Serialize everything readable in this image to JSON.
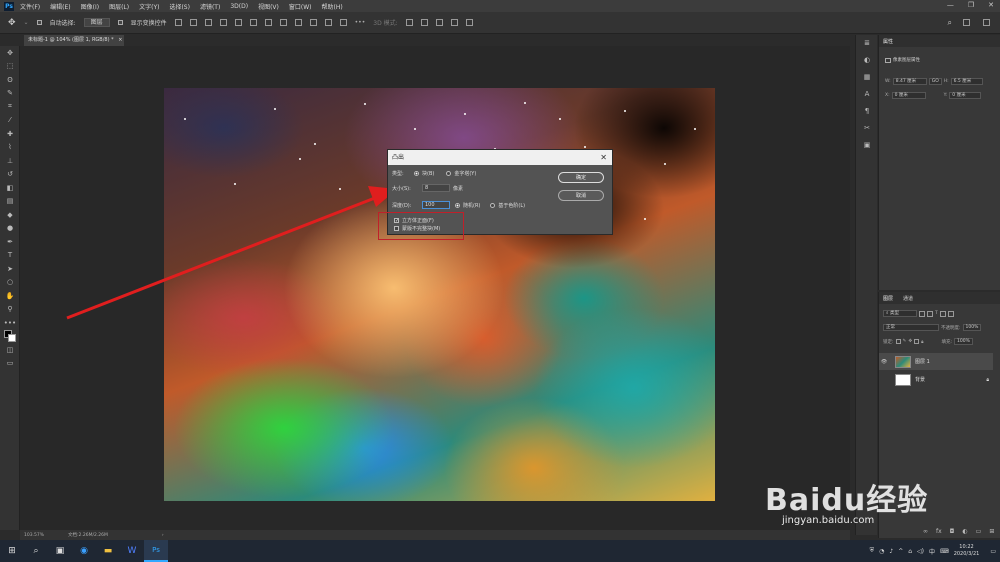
{
  "menubar": {
    "logo": "Ps",
    "items": [
      "文件(F)",
      "编辑(E)",
      "图像(I)",
      "图层(L)",
      "文字(Y)",
      "选择(S)",
      "滤镜(T)",
      "3D(D)",
      "视图(V)",
      "窗口(W)",
      "帮助(H)"
    ],
    "window_controls": [
      "—",
      "❐",
      "✕"
    ]
  },
  "options": {
    "auto_select": "自动选择:",
    "auto_select_value": "图层",
    "show_transform": "显示变换控件",
    "mode_3d": "3D 模式:"
  },
  "document_tab": "未标题-1 @ 104% (图层 1, RGB/8) *",
  "dialog": {
    "title": "凸出",
    "type_label": "类型:",
    "type_block": "块(B)",
    "type_pyramid": "金字塔(Y)",
    "size_label": "大小(S):",
    "size_value": "8",
    "size_unit": "像素",
    "depth_label": "深度(D):",
    "depth_value": "100",
    "depth_random": "随机(R)",
    "depth_level": "基于色阶(L)",
    "solid_front": "立方体正面(F)",
    "mask_incomplete": "蒙版不完整块(M)",
    "ok": "确定",
    "cancel": "取消"
  },
  "properties": {
    "tab_props": "属性",
    "title": "像素图层属性",
    "w_label": "W:",
    "w_value": "8.47 厘米",
    "go_label": "GO",
    "h_label": "H:",
    "h_value": "6.5 厘米",
    "x_label": "X:",
    "x_value": "0 厘米",
    "y_label": "Y:",
    "y_value": "0 厘米"
  },
  "layers": {
    "tab_layers": "图层",
    "tab_channels": "通道",
    "filter": "类型",
    "blend_mode": "正常",
    "opacity_label": "不透明度:",
    "opacity_value": "100%",
    "lock_label": "锁定:",
    "fill_label": "填充:",
    "fill_value": "100%",
    "items": [
      {
        "name": "图层 1"
      },
      {
        "name": "背景"
      }
    ]
  },
  "statusbar": {
    "zoom": "103.57%",
    "doc_size": "文档:2.26M/2.26M"
  },
  "taskbar": {
    "time": "10:22",
    "date": "2020/3/21",
    "ime": "中"
  },
  "watermark": {
    "brand": "Baidu经验",
    "url": "jingyan.baidu.com"
  },
  "colors": {
    "highlight": "#c0202a",
    "arrow": "#e01e1e",
    "accent": "#31a8ff"
  }
}
